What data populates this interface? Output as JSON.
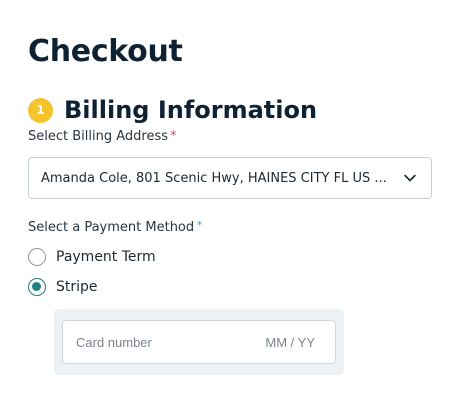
{
  "page": {
    "title": "Checkout"
  },
  "billing": {
    "step_number": "1",
    "section_title": "Billing Information",
    "address_label": "Select Billing Address",
    "address_required_mark": "*",
    "address_value": "Amanda Cole, 801 Scenic Hwy, HAINES CITY FL US ..."
  },
  "payment": {
    "label": "Select a Payment Method",
    "required_mark": "*",
    "options": [
      {
        "label": "Payment Term",
        "selected": false
      },
      {
        "label": "Stripe",
        "selected": true
      }
    ],
    "card": {
      "number_placeholder": "Card number",
      "expiry_placeholder": "MM / YY"
    }
  },
  "colors": {
    "step_badge": "#f5c42c",
    "radio_selected": "#1f7f85",
    "required_red": "#e2475a",
    "required_blue": "#3d8fd6"
  }
}
